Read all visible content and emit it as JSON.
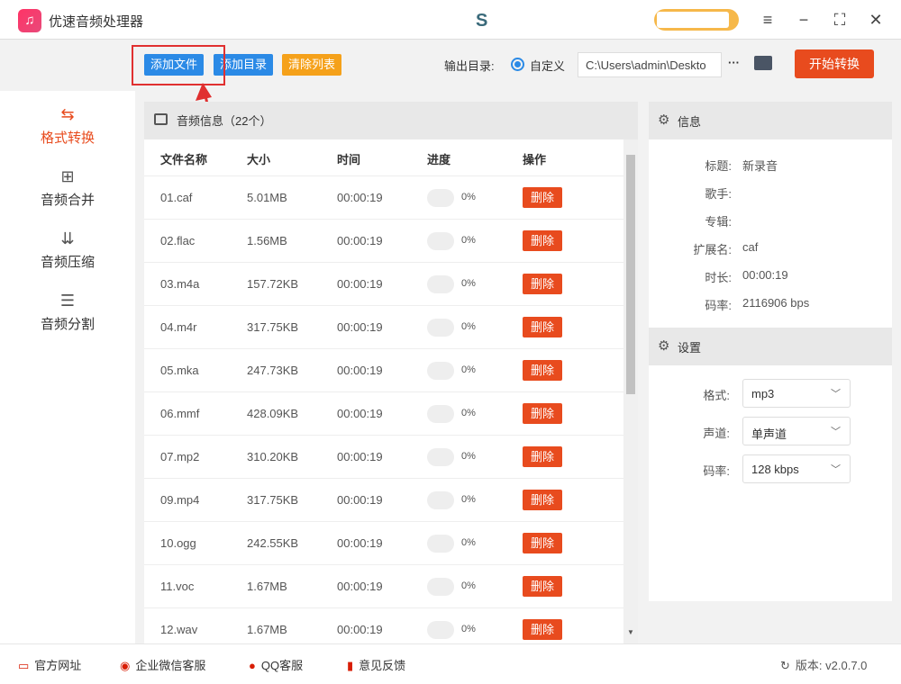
{
  "app": {
    "title": "优速音频处理器"
  },
  "toolbar": {
    "add_file": "添加文件",
    "add_dir": "添加目录",
    "clear_list": "清除列表",
    "output_label": "输出目录:",
    "output_option": "自定义",
    "output_path": "C:\\Users\\admin\\Deskto",
    "more": "···",
    "start": "开始转换"
  },
  "sidebar": {
    "items": [
      {
        "label": "格式转换",
        "icon": "⇆"
      },
      {
        "label": "音频合并",
        "icon": "⊞"
      },
      {
        "label": "音频压缩",
        "icon": "⇊"
      },
      {
        "label": "音频分割",
        "icon": "☰"
      }
    ]
  },
  "list": {
    "title": "音频信息（22个）",
    "headers": [
      "文件名称",
      "大小",
      "时间",
      "进度",
      "操作"
    ],
    "rows": [
      {
        "name": "01.caf",
        "size": "5.01MB",
        "time": "00:00:19",
        "progress": "0%",
        "action": "删除"
      },
      {
        "name": "02.flac",
        "size": "1.56MB",
        "time": "00:00:19",
        "progress": "0%",
        "action": "删除"
      },
      {
        "name": "03.m4a",
        "size": "157.72KB",
        "time": "00:00:19",
        "progress": "0%",
        "action": "删除"
      },
      {
        "name": "04.m4r",
        "size": "317.75KB",
        "time": "00:00:19",
        "progress": "0%",
        "action": "删除"
      },
      {
        "name": "05.mka",
        "size": "247.73KB",
        "time": "00:00:19",
        "progress": "0%",
        "action": "删除"
      },
      {
        "name": "06.mmf",
        "size": "428.09KB",
        "time": "00:00:19",
        "progress": "0%",
        "action": "删除"
      },
      {
        "name": "07.mp2",
        "size": "310.20KB",
        "time": "00:00:19",
        "progress": "0%",
        "action": "删除"
      },
      {
        "name": "09.mp4",
        "size": "317.75KB",
        "time": "00:00:19",
        "progress": "0%",
        "action": "删除"
      },
      {
        "name": "10.ogg",
        "size": "242.55KB",
        "time": "00:00:19",
        "progress": "0%",
        "action": "删除"
      },
      {
        "name": "11.voc",
        "size": "1.67MB",
        "time": "00:00:19",
        "progress": "0%",
        "action": "删除"
      },
      {
        "name": "12.wav",
        "size": "1.67MB",
        "time": "00:00:19",
        "progress": "0%",
        "action": "删除"
      }
    ]
  },
  "info": {
    "title": "信息",
    "fields": [
      {
        "k": "标题:",
        "v": "新录音"
      },
      {
        "k": "歌手:",
        "v": ""
      },
      {
        "k": "专辑:",
        "v": ""
      },
      {
        "k": "扩展名:",
        "v": "caf"
      },
      {
        "k": "时长:",
        "v": "00:00:19"
      },
      {
        "k": "码率:",
        "v": "2116906 bps"
      }
    ]
  },
  "settings": {
    "title": "设置",
    "fields": [
      {
        "k": "格式:",
        "v": "mp3"
      },
      {
        "k": "声道:",
        "v": "单声道"
      },
      {
        "k": "码率:",
        "v": "128 kbps"
      }
    ]
  },
  "footer": {
    "website": "官方网址",
    "wechat": "企业微信客服",
    "qq": "QQ客服",
    "feedback": "意见反馈",
    "version": "版本: v2.0.7.0"
  }
}
